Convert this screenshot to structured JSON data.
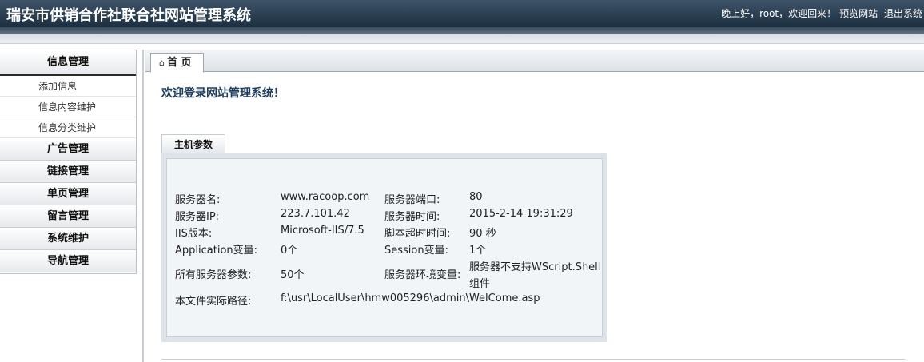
{
  "header": {
    "title": "瑞安市供销合作社联合社网站管理系统",
    "greeting": "晚上好，root，欢迎回来！",
    "preview_link": "预览网站",
    "logout_link": "退出系统"
  },
  "sidebar": {
    "sections": [
      {
        "label": "信息管理",
        "items": [
          "添加信息",
          "信息内容维护",
          "信息分类维护"
        ]
      },
      {
        "label": "广告管理"
      },
      {
        "label": "链接管理"
      },
      {
        "label": "单页管理"
      },
      {
        "label": "留言管理"
      },
      {
        "label": "系统维护"
      },
      {
        "label": "导航管理"
      }
    ]
  },
  "tabs": {
    "home_icon": "home-icon",
    "home_label": "首 页"
  },
  "main": {
    "welcome": "欢迎登录网站管理系统！",
    "host_tab": "主机参数",
    "params": {
      "server_name_label": "服务器名:",
      "server_name": "www.racoop.com",
      "server_port_label": "服务器端口:",
      "server_port": "80",
      "server_ip_label": "服务器IP:",
      "server_ip": "223.7.101.42",
      "server_time_label": "服务器时间:",
      "server_time": "2015-2-14 19:31:29",
      "iis_label": "IIS版本:",
      "iis": "Microsoft-IIS/7.5",
      "script_timeout_label": "脚本超时时间:",
      "script_timeout": "90 秒",
      "app_var_label": "Application变量:",
      "app_var": "0个",
      "session_var_label": "Session变量:",
      "session_var": "1个",
      "all_params_label": "所有服务器参数:",
      "all_params": "50个",
      "env_var_label": "服务器环境变量:",
      "env_var_line1": "服务器不支持WScript.Shell",
      "env_var_line2": "组件",
      "path_label": "本文件实际路径:",
      "path": "f:\\usr\\LocalUser\\hmw005296\\admin\\WelCome.asp"
    }
  }
}
